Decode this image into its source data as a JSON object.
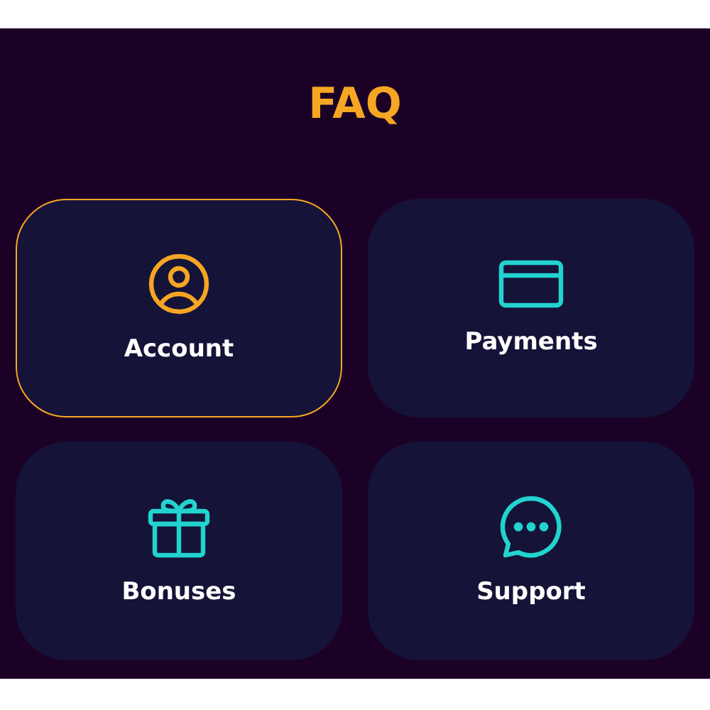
{
  "title": "FAQ",
  "categories": [
    {
      "label": "Account",
      "kind": "person",
      "selected": true
    },
    {
      "label": "Payments",
      "kind": "card",
      "selected": false
    },
    {
      "label": "Bonuses",
      "kind": "gift",
      "selected": false
    },
    {
      "label": "Support",
      "kind": "chat",
      "selected": false
    }
  ]
}
